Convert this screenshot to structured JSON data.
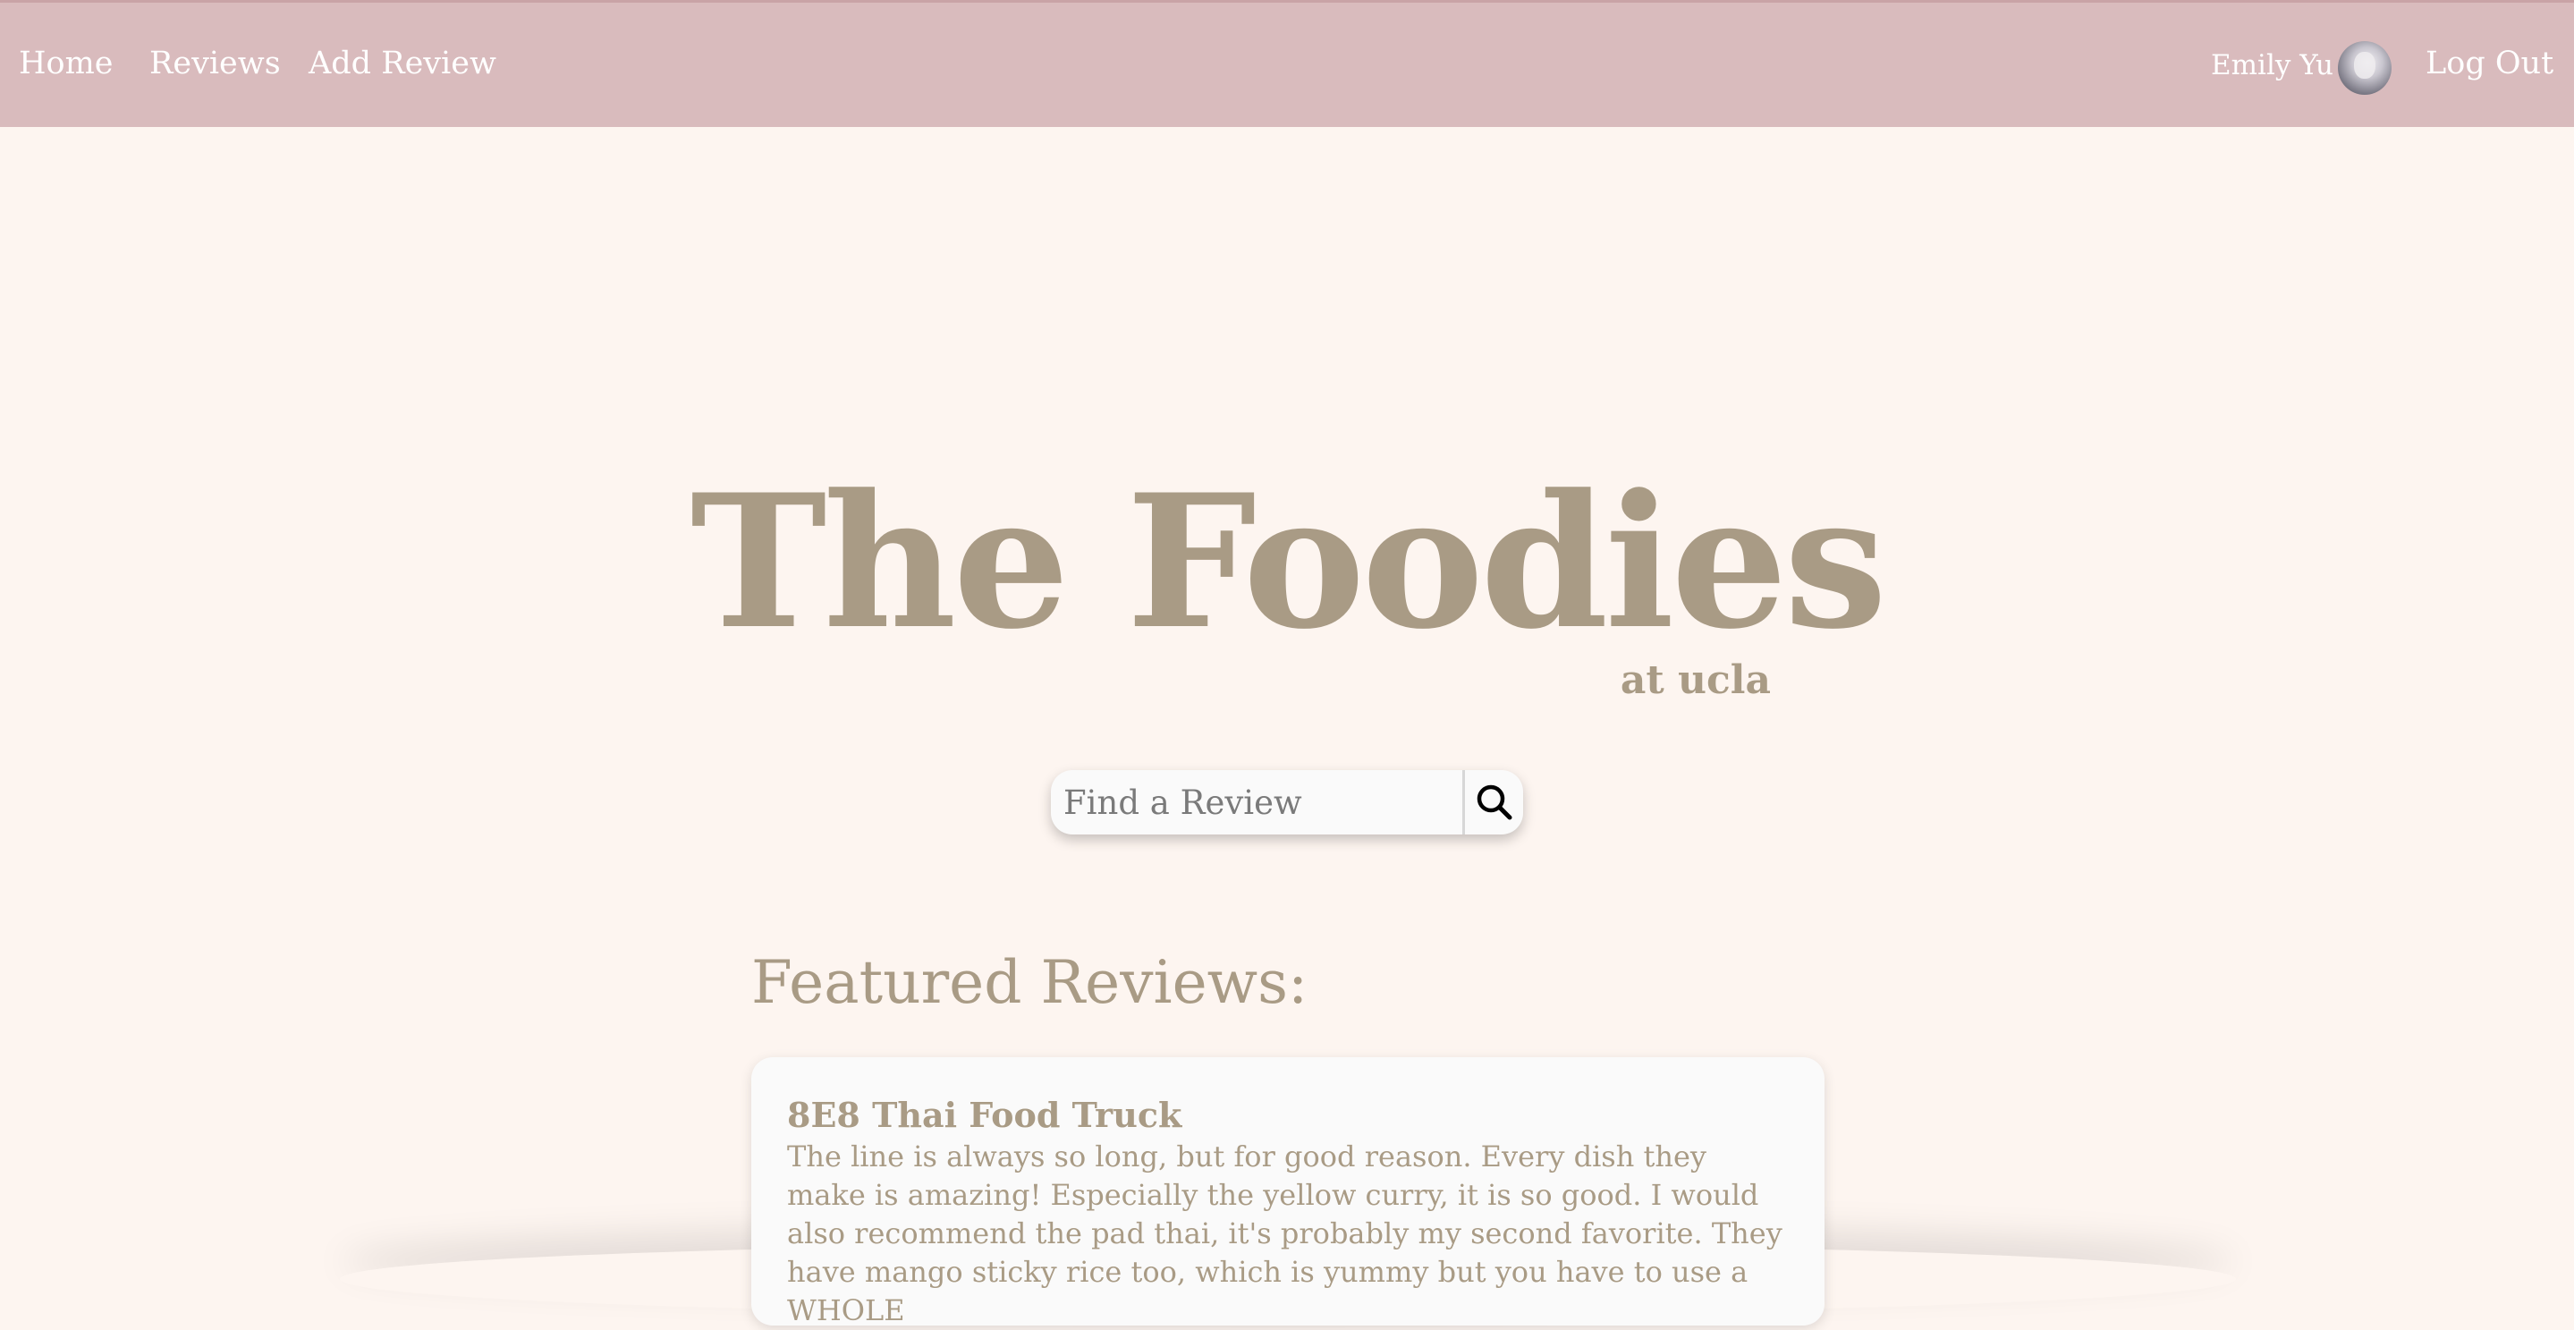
{
  "navbar": {
    "home_label": "Home",
    "reviews_label": "Reviews",
    "add_review_label": "Add Review",
    "user_name": "Emily Yu",
    "logout_label": "Log Out",
    "background_color": "#d9bbbd",
    "avatar_icon": "user-avatar-icon"
  },
  "hero": {
    "title": "The Foodies",
    "subtitle": "at ucla",
    "color": "#a99b85"
  },
  "search": {
    "placeholder": "Find a Review",
    "value": "",
    "button_icon": "search-icon"
  },
  "featured": {
    "heading": "Featured Reviews:",
    "reviews": [
      {
        "title": "8E8 Thai Food Truck",
        "body": "The line is always so long, but for good reason. Every dish they make is amazing! Especially the yellow curry, it is so good. I would also recommend the pad thai, it's probably my second favorite. They have mango sticky rice too, which is yummy but you have to use a WHOLE"
      }
    ]
  },
  "page_background": "#fdf5f0"
}
